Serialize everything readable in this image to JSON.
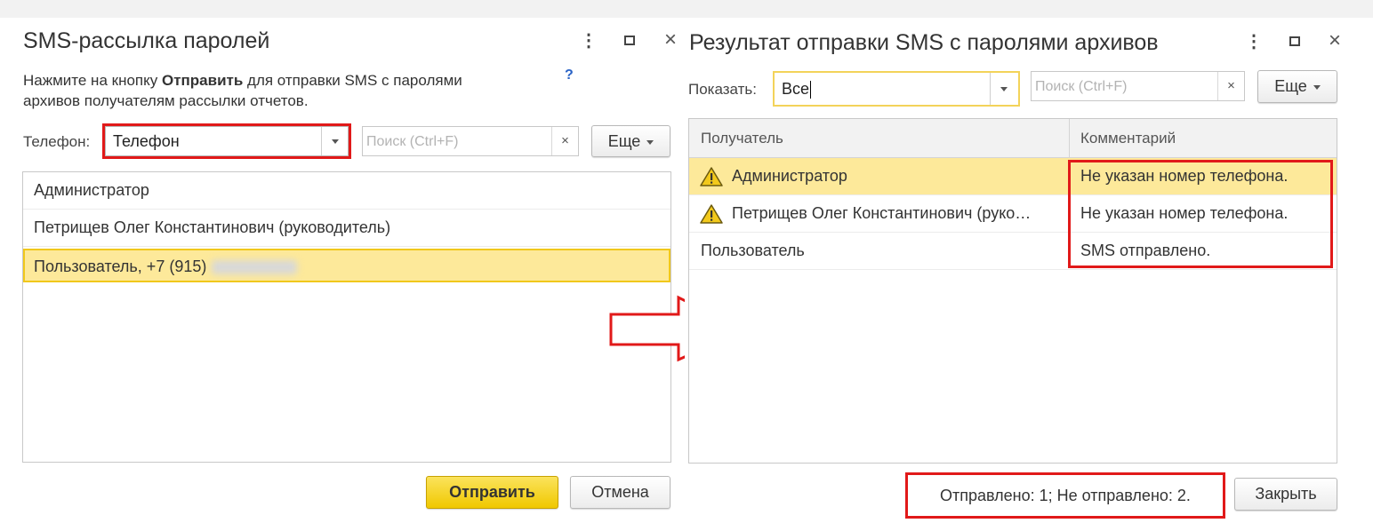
{
  "left_window": {
    "title": "SMS-рассылка паролей",
    "description_prefix": "Нажмите на кнопку ",
    "description_bold": "Отправить",
    "description_line1_suffix": " для отправки SMS с паролями",
    "description_line2": "архивов получателям рассылки отчетов.",
    "help_label": "?",
    "phone_label": "Телефон:",
    "phone_value": "Телефон",
    "search_placeholder": "Поиск (Ctrl+F)",
    "clear_label": "×",
    "more_label": "Еще",
    "recipients": [
      "Администратор",
      "Петрищев Олег Константинович (руководитель)",
      "Пользователь, +7 (915)"
    ],
    "send_label": "Отправить",
    "cancel_label": "Отмена"
  },
  "right_window": {
    "title": "Результат отправки SMS с паролями архивов",
    "show_label": "Показать:",
    "show_value": "Все",
    "search_placeholder": "Поиск (Ctrl+F)",
    "clear_label": "×",
    "more_label": "Еще",
    "columns": {
      "recipient": "Получатель",
      "comment": "Комментарий"
    },
    "rows": [
      {
        "recipient": "Администратор",
        "comment": "Не указан номер телефона."
      },
      {
        "recipient": "Петрищев Олег Константинович (руко…",
        "comment": "Не указан номер телефона."
      },
      {
        "recipient": "Пользователь",
        "comment": "SMS отправлено."
      }
    ],
    "status": "Отправлено: 1; Не отправлено: 2.",
    "close_label": "Закрыть"
  },
  "window_controls": {
    "menu": "⋮",
    "close": "×"
  },
  "colors": {
    "selection": "#fde99a",
    "highlight_border": "#e11919",
    "primary_button": "#f5d31a"
  }
}
